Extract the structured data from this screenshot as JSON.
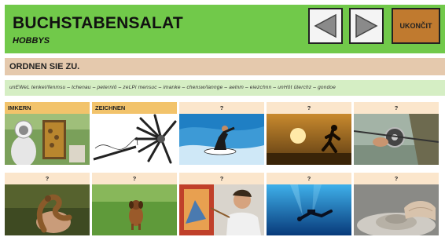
{
  "header": {
    "title": "BUCHSTABENSALAT",
    "subtitle": "HOBBYS",
    "end_label": "UKONČIT",
    "bg_color": "#71c94a"
  },
  "nav": {
    "prev_icon": "triangle-left-icon",
    "next_icon": "triangle-right-icon"
  },
  "instruction": "ORDNEN SIE ZU.",
  "word_bank": "unEWeL tenkeI/fenmsu – tchenau – peterniö – zeLPi mensuc – imanke – chensw/lannge – aelnm – eiezchnn – unHöt üterchz – gondoe",
  "cards": [
    {
      "label": "IMKERN",
      "image": "beekeeper-photo"
    },
    {
      "label": "ZEICHNEN",
      "image": "pencils-photo"
    },
    {
      "label": "?",
      "image": "surfer-photo"
    },
    {
      "label": "?",
      "image": "runner-sunset-photo"
    },
    {
      "label": "?",
      "image": "fishing-reel-photo"
    },
    {
      "label": "?",
      "image": "snake-hands-photo"
    },
    {
      "label": "?",
      "image": "dog-running-photo"
    },
    {
      "label": "?",
      "image": "painter-photo"
    },
    {
      "label": "?",
      "image": "diver-photo"
    },
    {
      "label": "?",
      "image": "pottery-photo"
    }
  ]
}
